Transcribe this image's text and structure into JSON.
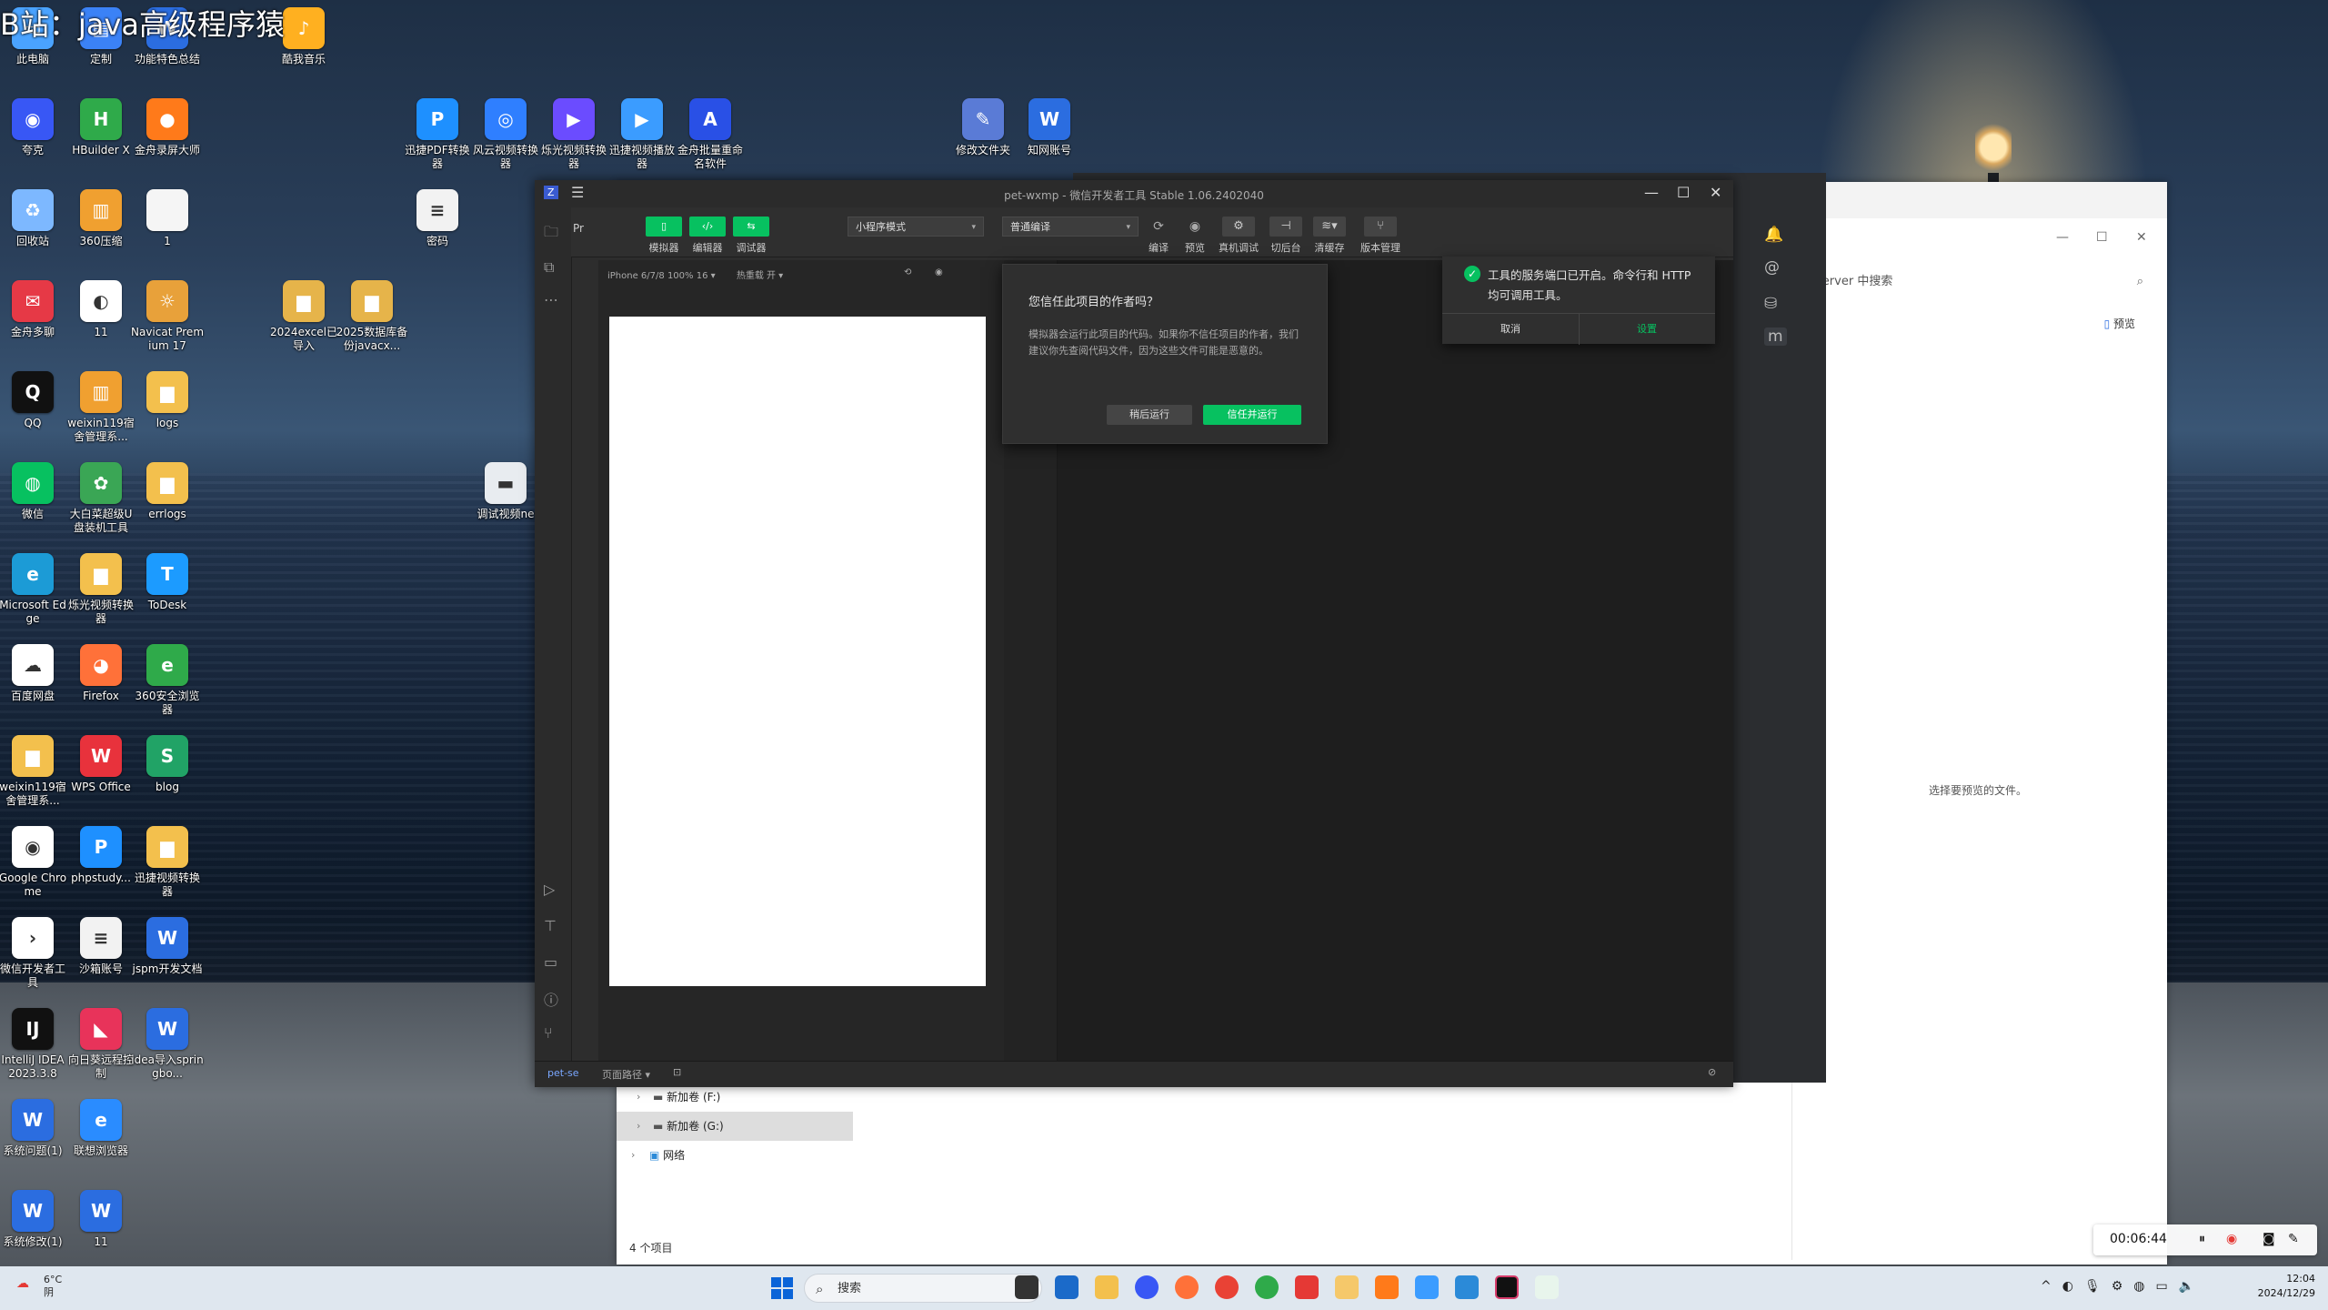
{
  "watermark": "B站：java高级程序猿",
  "desktop_icons": [
    {
      "label": "此电脑",
      "color": "#4aa3ff",
      "glyph": "▭"
    },
    {
      "label": "定制",
      "color": "#3b82f6",
      "glyph": "▤"
    },
    {
      "label": "功能特色总结",
      "color": "#2b6de0",
      "glyph": "W"
    },
    {
      "label": "酷我音乐",
      "color": "#ffb020",
      "glyph": "♪"
    },
    {
      "label": "夸克",
      "color": "#3857f5",
      "glyph": "◉"
    },
    {
      "label": "HBuilder X",
      "color": "#2faa4a",
      "glyph": "H"
    },
    {
      "label": "金舟录屏大师",
      "color": "#ff7a1a",
      "glyph": "●"
    },
    {
      "label": "迅捷PDF转换器",
      "color": "#1e90ff",
      "glyph": "P"
    },
    {
      "label": "风云视频转换器",
      "color": "#2f7fff",
      "glyph": "◎"
    },
    {
      "label": "烁光视频转换器",
      "color": "#6b4cff",
      "glyph": "▶"
    },
    {
      "label": "迅捷视频播放器",
      "color": "#3b9cff",
      "glyph": "▶"
    },
    {
      "label": "金舟批量重命名软件",
      "color": "#2950e6",
      "glyph": "A"
    },
    {
      "label": "修改文件夹",
      "color": "#5a7bd6",
      "glyph": "✎"
    },
    {
      "label": "知网账号",
      "color": "#2b6de0",
      "glyph": "W"
    },
    {
      "label": "回收站",
      "color": "#7db8ff",
      "glyph": "♻"
    },
    {
      "label": "360压缩",
      "color": "#f0a030",
      "glyph": "▥"
    },
    {
      "label": "1",
      "color": "#f5f5f5",
      "glyph": ""
    },
    {
      "label": "密码",
      "color": "#f2f2f2",
      "glyph": "≡"
    },
    {
      "label": "金舟多聊",
      "color": "#e63946",
      "glyph": "✉"
    },
    {
      "label": "11",
      "color": "#ffffff",
      "glyph": "◐"
    },
    {
      "label": "Navicat Premium 17",
      "color": "#e8a13a",
      "glyph": "☼"
    },
    {
      "label": "2024excel已导入",
      "color": "#e6b44a",
      "glyph": "▆"
    },
    {
      "label": "2025数据库备份javacx...",
      "color": "#e6b44a",
      "glyph": "▆"
    },
    {
      "label": "QQ",
      "color": "#111111",
      "glyph": "Q"
    },
    {
      "label": "weixin119宿舍管理系...",
      "color": "#f0a030",
      "glyph": "▥"
    },
    {
      "label": "logs",
      "color": "#f3c04d",
      "glyph": "▆"
    },
    {
      "label": "微信",
      "color": "#07c160",
      "glyph": "◍"
    },
    {
      "label": "大白菜超级U盘装机工具",
      "color": "#3aa655",
      "glyph": "✿"
    },
    {
      "label": "errlogs",
      "color": "#f3c04d",
      "glyph": "▆"
    },
    {
      "label": "调试视频ne",
      "color": "#e8ecf0",
      "glyph": "▬"
    },
    {
      "label": "Microsoft Edge",
      "color": "#1c9bd6",
      "glyph": "e"
    },
    {
      "label": "烁光视频转换器",
      "color": "#f3c04d",
      "glyph": "▆"
    },
    {
      "label": "ToDesk",
      "color": "#1c9bff",
      "glyph": "T"
    },
    {
      "label": "百度网盘",
      "color": "#ffffff",
      "glyph": "☁"
    },
    {
      "label": "Firefox",
      "color": "#ff7139",
      "glyph": "◕"
    },
    {
      "label": "360安全浏览器",
      "color": "#2faa4a",
      "glyph": "e"
    },
    {
      "label": "weixin119宿舍管理系...",
      "color": "#f3c04d",
      "glyph": "▆"
    },
    {
      "label": "WPS Office",
      "color": "#e8323c",
      "glyph": "W"
    },
    {
      "label": "blog",
      "color": "#21a366",
      "glyph": "S"
    },
    {
      "label": "Google Chrome",
      "color": "#ffffff",
      "glyph": "◉"
    },
    {
      "label": "phpstudy...",
      "color": "#1e90ff",
      "glyph": "P"
    },
    {
      "label": "迅捷视频转换器",
      "color": "#f3c04d",
      "glyph": "▆"
    },
    {
      "label": "微信开发者工具",
      "color": "#ffffff",
      "glyph": "›"
    },
    {
      "label": "沙箱账号",
      "color": "#f2f2f2",
      "glyph": "≡"
    },
    {
      "label": "jspm开发文档",
      "color": "#2b6de0",
      "glyph": "W"
    },
    {
      "label": "IntelliJ IDEA 2023.3.8",
      "color": "#111111",
      "glyph": "IJ"
    },
    {
      "label": "向日葵远程控制",
      "color": "#e8335a",
      "glyph": "◣"
    },
    {
      "label": "idea导入springbo...",
      "color": "#2b6de0",
      "glyph": "W"
    },
    {
      "label": "系统问题(1)",
      "color": "#2b6de0",
      "glyph": "W"
    },
    {
      "label": "联想浏览器",
      "color": "#2a8cff",
      "glyph": "e"
    },
    {
      "label": "系统修改(1)",
      "color": "#2b6de0",
      "glyph": "W"
    },
    {
      "label": "11",
      "color": "#2b6de0",
      "glyph": "W"
    }
  ],
  "explorer": {
    "tree": [
      {
        "label": "新加卷 (F:)",
        "selected": false
      },
      {
        "label": "新加卷 (G:)",
        "selected": true
      },
      {
        "label": "网络",
        "selected": false
      }
    ],
    "status": "4 个项目",
    "search_placeholder": "pet-server 中搜索",
    "preview_label": "预览",
    "preview_empty": "选择要预览的文件。"
  },
  "devtools": {
    "title": "pet-wxmp - 微信开发者工具 Stable 1.06.2402040",
    "toolbar": {
      "simulator": "模拟器",
      "editor": "编辑器",
      "debugger": "调试器",
      "mode_select": "小程序模式",
      "compile_select": "普通编译",
      "compile": "编译",
      "preview": "预览",
      "real_debug": "真机调试",
      "background": "切后台",
      "clear_cache": "清缓存",
      "version": "版本管理"
    },
    "device_info": "iPhone 6/7/8 100% 16 ▾",
    "hot_reload": "热重载 开 ▾",
    "bottom_path": "页面路径 ▾",
    "project_short": "pet-se",
    "dialog": {
      "title": "您信任此项目的作者吗？",
      "body": "模拟器会运行此项目的代码。如果你不信任项目的作者，我们建议你先查阅代码文件，因为这些文件可能是恶意的。",
      "later": "稍后运行",
      "trust": "信任并运行"
    },
    "notify": {
      "text": "工具的服务端口已开启。命令行和 HTTP 均可调用工具。",
      "cancel": "取消",
      "settings": "设置"
    }
  },
  "taskbar": {
    "temperature": "6°C",
    "weather": "阴",
    "search": "搜索",
    "time": "12:04",
    "date": "2024/12/29"
  },
  "recorder": {
    "elapsed": "00:06:44"
  }
}
